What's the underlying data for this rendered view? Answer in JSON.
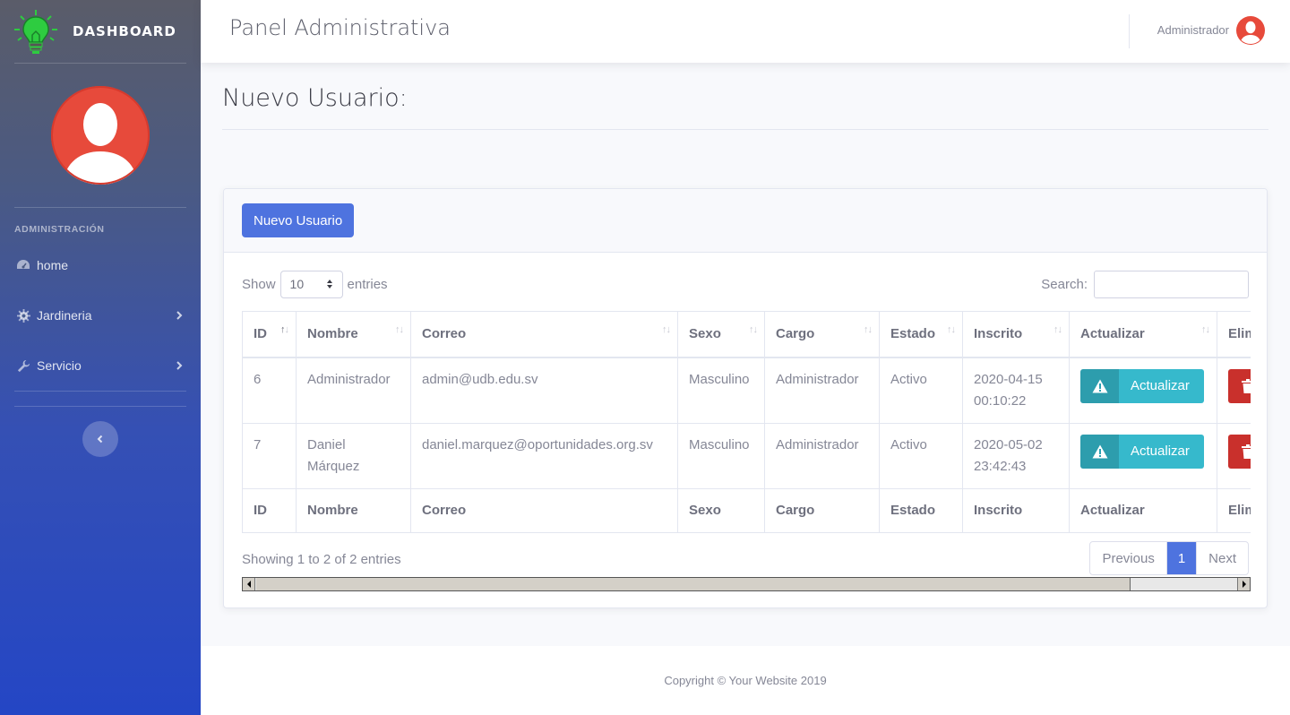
{
  "sidebar": {
    "brand": "DASHBOARD",
    "heading": "ADMINISTRACIÓN",
    "items": [
      {
        "label": "home",
        "icon": "tachometer-icon"
      },
      {
        "label": "Jardineria",
        "icon": "cog-icon"
      },
      {
        "label": "Servicio",
        "icon": "wrench-icon"
      }
    ]
  },
  "topbar": {
    "title": "Panel Administrativa",
    "user": "Administrador"
  },
  "page": {
    "heading": "Nuevo Usuario:"
  },
  "card": {
    "new_button": "Nuevo Usuario",
    "show_label": "Show",
    "show_value": "10",
    "entries_label": "entries",
    "search_label": "Search:",
    "search_value": "",
    "columns": [
      "ID",
      "Nombre",
      "Correo",
      "Sexo",
      "Cargo",
      "Estado",
      "Inscrito",
      "Actualizar",
      "Eliminar"
    ],
    "rows": [
      {
        "id": "6",
        "nombre": "Administrador",
        "correo": "admin@udb.edu.sv",
        "sexo": "Masculino",
        "cargo": "Administrador",
        "estado": "Activo",
        "inscrito": "2020-04-15 00:10:22",
        "update_label": "Actualizar"
      },
      {
        "id": "7",
        "nombre": "Daniel Márquez",
        "correo": "daniel.marquez@oportunidades.org.sv",
        "sexo": "Masculino",
        "cargo": "Administrador",
        "estado": "Activo",
        "inscrito": "2020-05-02 23:42:43",
        "update_label": "Actualizar"
      }
    ],
    "info": "Showing 1 to 2 of 2 entries",
    "pagination": {
      "previous": "Previous",
      "current": "1",
      "next": "Next"
    }
  },
  "footer": {
    "copyright": "Copyright © Your Website 2019"
  },
  "colors": {
    "primary": "#4e73df",
    "info": "#36b9cc",
    "danger": "#c9302c",
    "avatar": "#e74a3b"
  }
}
